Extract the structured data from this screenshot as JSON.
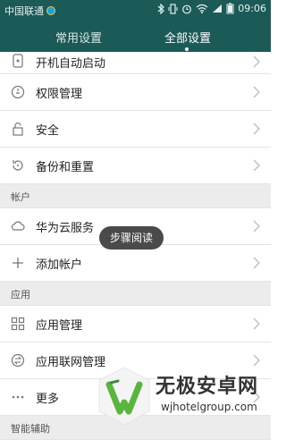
{
  "status_bar": {
    "carrier": "中国联通",
    "time": "09:06"
  },
  "tabs": [
    {
      "label": "常用设置"
    },
    {
      "label": "全部设置",
      "active": true
    }
  ],
  "rows_top": [
    {
      "label": "开机自动启动",
      "icon": "power-icon"
    },
    {
      "label": "权限管理",
      "icon": "shield-icon"
    },
    {
      "label": "安全",
      "icon": "lock-icon"
    },
    {
      "label": "备份和重置",
      "icon": "restore-icon"
    }
  ],
  "section_account": "帐户",
  "rows_account": [
    {
      "label": "华为云服务",
      "icon": "cloud-icon"
    },
    {
      "label": "添加帐户",
      "icon": "plus-icon"
    }
  ],
  "section_apps": "应用",
  "rows_apps": [
    {
      "label": "应用管理",
      "icon": "grid-icon"
    },
    {
      "label": "应用联网管理",
      "icon": "network-icon"
    },
    {
      "label": "更多",
      "icon": "more-icon"
    }
  ],
  "section_smart": "智能辅助",
  "toast": "步骤阅读",
  "watermark": {
    "title": "无极安卓网",
    "url": "wjhotelgroup.com"
  },
  "colors": {
    "header": "#1b5a57",
    "section_bg": "#ececec"
  }
}
